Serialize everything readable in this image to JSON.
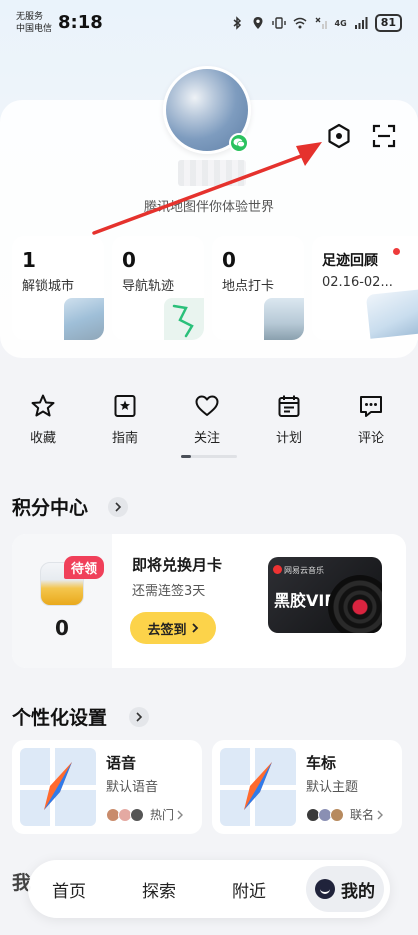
{
  "status_bar": {
    "carrier_line1": "无服务",
    "carrier_line2": "中国电信",
    "time": "8:18",
    "network": "4G",
    "battery": "81"
  },
  "profile": {
    "subtitle": "腾讯地图伴你体验世界"
  },
  "stats": [
    {
      "value": "1",
      "label": "解锁城市"
    },
    {
      "value": "0",
      "label": "导航轨迹"
    },
    {
      "value": "0",
      "label": "地点打卡"
    }
  ],
  "footprint": {
    "title": "足迹回顾",
    "date": "02.16-02..."
  },
  "shortcuts": [
    {
      "label": "收藏",
      "icon": "star-outline-icon"
    },
    {
      "label": "指南",
      "icon": "guide-book-icon"
    },
    {
      "label": "关注",
      "icon": "heart-outline-icon"
    },
    {
      "label": "计划",
      "icon": "calendar-icon"
    },
    {
      "label": "评论",
      "icon": "comment-icon"
    }
  ],
  "points_section": {
    "title": "积分中心",
    "badge": "待领",
    "count": "0",
    "redeem_title": "即将兑换月卡",
    "redeem_sub": "还需连签3天",
    "checkin_label": "去签到",
    "vip_brand": "网易云音乐",
    "vip_text": "黑胶VIP"
  },
  "personalization": {
    "title": "个性化设置",
    "cards": [
      {
        "title": "语音",
        "sub": "默认语音",
        "foot": "热门"
      },
      {
        "title": "车标",
        "sub": "默认主题",
        "foot": "联名"
      }
    ]
  },
  "partial_section_title": "我",
  "tabbar": {
    "tabs": [
      "首页",
      "探索",
      "附近"
    ],
    "active": "我的"
  },
  "colors": {
    "accent_yellow": "#fcd34a",
    "badge_red": "#f0405a",
    "wechat_green": "#2bc25f",
    "annotation_red": "#e5322d"
  }
}
